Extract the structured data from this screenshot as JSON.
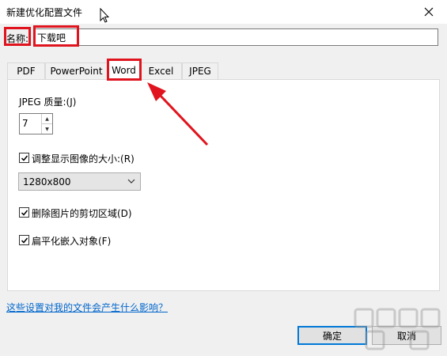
{
  "window": {
    "title": "新建优化配置文件"
  },
  "name_field": {
    "label": "名称:",
    "value": "下载吧"
  },
  "tabs": [
    {
      "label": "PDF"
    },
    {
      "label": "PowerPoint"
    },
    {
      "label": "Word"
    },
    {
      "label": "Excel"
    },
    {
      "label": "JPEG"
    }
  ],
  "active_tab": "Word",
  "jpeg_quality": {
    "label": "JPEG 质量:(J)",
    "value": "7"
  },
  "resize_images": {
    "label": "调整显示图像的大小:(R)",
    "checked": true
  },
  "resolution": {
    "selected": "1280x800"
  },
  "delete_crop": {
    "label": "删除图片的剪切区域(D)",
    "checked": true
  },
  "flatten": {
    "label": "扁平化嵌入对象(F)",
    "checked": true
  },
  "help_link": "这些设置对我的文件会产生什么影响？",
  "buttons": {
    "ok": "确定",
    "cancel": "取消"
  },
  "colors": {
    "highlight": "#e0141e",
    "link": "#0066cc",
    "default_button_border": "#0078d7"
  }
}
